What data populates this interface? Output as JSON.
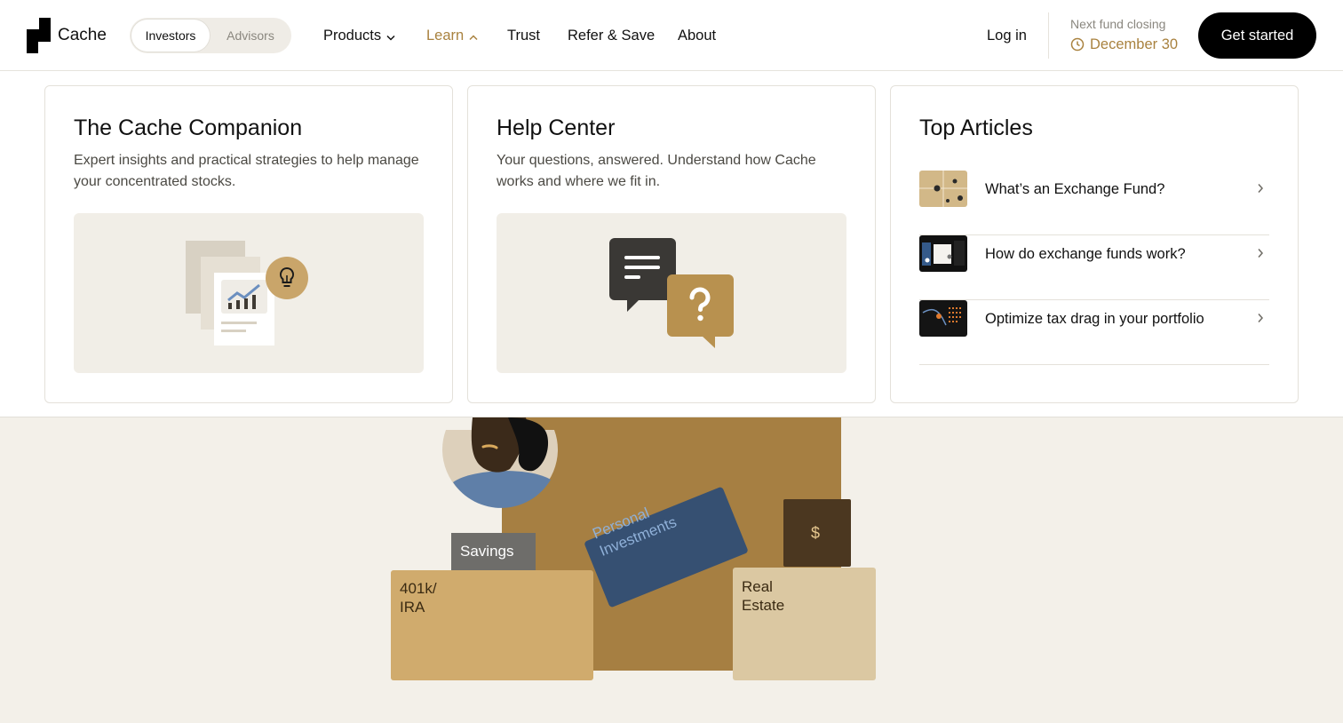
{
  "brand": {
    "name": "Cache"
  },
  "audience_toggle": {
    "options": [
      "Investors",
      "Advisors"
    ],
    "selected": "Investors"
  },
  "nav": {
    "products": "Products",
    "learn": "Learn",
    "trust": "Trust",
    "refer": "Refer & Save",
    "about": "About"
  },
  "header": {
    "login": "Log in",
    "fund_label": "Next fund closing",
    "fund_date": "December 30",
    "cta": "Get started"
  },
  "dropdown": {
    "companion": {
      "title": "The Cache Companion",
      "description": "Expert insights and practical strategies to help manage your concentrated stocks."
    },
    "help": {
      "title": "Help Center",
      "description": "Your questions, answered. Understand how Cache works and where we fit in."
    },
    "articles": {
      "title": "Top Articles",
      "items": [
        "What’s an Exchange Fund?",
        "How do exchange funds work?",
        "Optimize tax drag in your portfolio"
      ]
    }
  },
  "hero": {
    "savings": "Savings",
    "personal": "Personal\nInvestments",
    "ira": "401k/\nIRA",
    "real_estate": "Real\nEstate",
    "dollar": "$"
  },
  "colors": {
    "accent": "#a9823f",
    "cta": "#000000",
    "panel_bg": "#f1eee7",
    "page_bg": "#f3f0e9"
  },
  "icons": [
    "chevron-down-icon",
    "chevron-up-icon",
    "clock-icon",
    "lightbulb-icon",
    "chat-icon",
    "question-icon",
    "chevron-right-icon"
  ]
}
